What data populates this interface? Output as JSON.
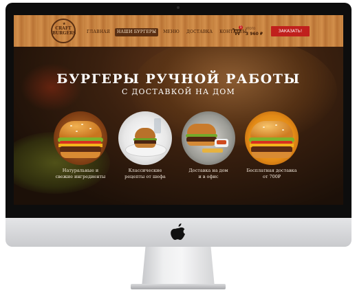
{
  "header": {
    "logo": {
      "line1": "CRAFT",
      "line2": "BURGERS"
    },
    "nav": [
      "ГЛАВНАЯ",
      "НАШИ БУРГЕРЫ",
      "МЕНЮ",
      "ДОСТАВКА",
      "КОНТАКТЫ"
    ],
    "active_nav_index": 1,
    "cart": {
      "count": "1",
      "total_label": "ИТОГО",
      "total_value": "3 960 ₽"
    },
    "order_button": "ЗАКАЗАТЬ!"
  },
  "hero": {
    "title": "БУРГЕРЫ РУЧНОЙ РАБОТЫ",
    "subtitle": "С ДОСТАВКОЙ НА ДОМ"
  },
  "features": [
    {
      "line1": "Натуральные и",
      "line2": "свежие ингредиенты"
    },
    {
      "line1": "Классические",
      "line2": "рецепты от шефа"
    },
    {
      "line1": "Доставка на дом",
      "line2": "и в офис"
    },
    {
      "line1": "Бесплатная доставка",
      "line2": "от 700₽"
    }
  ],
  "colors": {
    "accent": "#c0201d",
    "wood": "#c98642",
    "dark": "#1c1008",
    "nav_active": "#5a2f12"
  },
  "icons": [
    "cart-icon",
    "apple-logo-icon"
  ]
}
